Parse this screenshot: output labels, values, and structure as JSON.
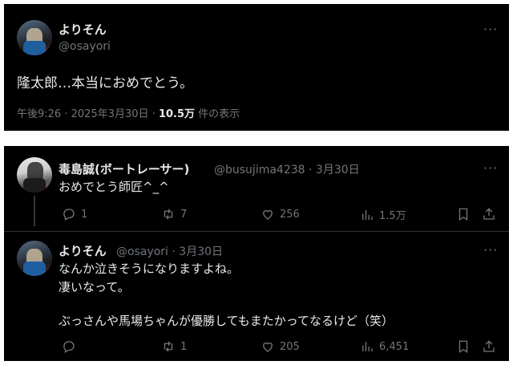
{
  "post": {
    "name": "よりそん",
    "handle": "@osayori",
    "text": "隆太郎…本当におめでとう。",
    "time": "午後9:26",
    "date": "2025年3月30日",
    "views_count": "10.5万",
    "views_label": "件の表示"
  },
  "reply": {
    "name": "毒島誠(ボートレーサー)",
    "handle": "@busujima4238",
    "date": "3月30日",
    "text": "おめでとう師匠^_^",
    "replies": "1",
    "reposts": "7",
    "likes": "256",
    "views": "1.5万"
  },
  "reply2": {
    "name": "よりそん",
    "handle": "@osayori",
    "date": "3月30日",
    "lines": [
      "なんか泣きそうになりますよね。",
      "凄いなって。",
      "",
      "ぶっさんや馬場ちゃんが優勝してもまたかってなるけど（笑）"
    ],
    "replies": "",
    "reposts": "1",
    "likes": "205",
    "views": "6,451"
  },
  "separator": "·",
  "more": "···",
  "icons": [
    "more-icon",
    "reply-icon",
    "repost-icon",
    "like-icon",
    "views-icon",
    "bookmark-icon",
    "share-icon"
  ]
}
